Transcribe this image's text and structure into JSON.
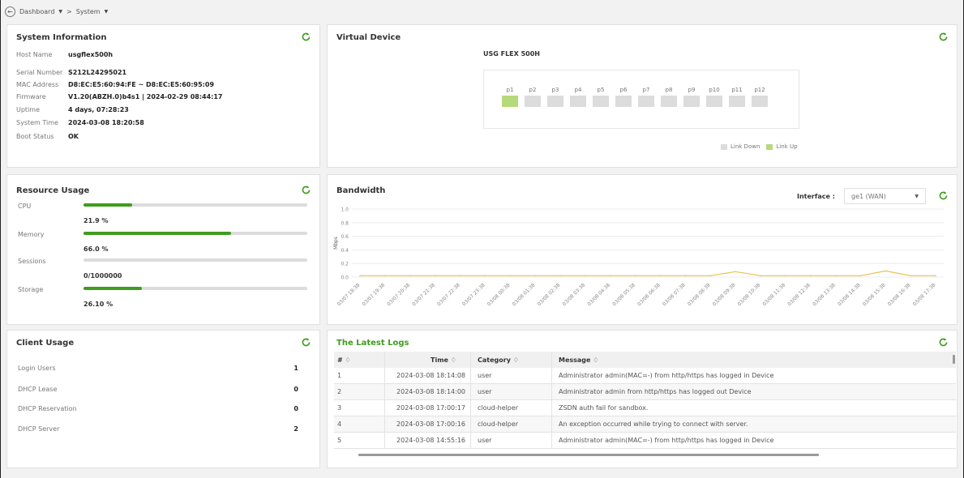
{
  "breadcrumb": {
    "home": "Dashboard",
    "separator": ">",
    "current": "System"
  },
  "colors": {
    "accent": "#3f9c1e",
    "link_up": "#b6d97b",
    "link_down": "#dcdcdc",
    "line": "#e8c24a"
  },
  "system_info": {
    "title": "System Information",
    "rows": [
      {
        "label": "Host Name",
        "value": "usgflex500h"
      },
      {
        "label": "Serial Number",
        "value": "S212L24295021"
      },
      {
        "label": "MAC Address",
        "value": "D8:EC:E5:60:94:FE ~ D8:EC:E5:60:95:09"
      },
      {
        "label": "Firmware",
        "value": "V1.20(ABZH.0)b4s1 | 2024-02-29 08:44:17"
      },
      {
        "label": "Uptime",
        "value": "4 days, 07:28:23"
      },
      {
        "label": "System Time",
        "value": "2024-03-08 18:20:58"
      },
      {
        "label": "Boot Status",
        "value": "OK"
      }
    ]
  },
  "virtual_device": {
    "title": "Virtual Device",
    "model": "USG FLEX 500H",
    "ports": [
      {
        "label": "p1",
        "status": "up"
      },
      {
        "label": "p2",
        "status": "down"
      },
      {
        "label": "p3",
        "status": "down"
      },
      {
        "label": "p4",
        "status": "down"
      },
      {
        "label": "p5",
        "status": "down"
      },
      {
        "label": "p6",
        "status": "down"
      },
      {
        "label": "p7",
        "status": "down"
      },
      {
        "label": "p8",
        "status": "down"
      },
      {
        "label": "p9",
        "status": "down"
      },
      {
        "label": "p10",
        "status": "down"
      },
      {
        "label": "p11",
        "status": "down"
      },
      {
        "label": "p12",
        "status": "down"
      }
    ],
    "legend_down": "Link Down",
    "legend_up": "Link Up"
  },
  "resource_usage": {
    "title": "Resource Usage",
    "items": [
      {
        "label": "CPU",
        "value_text": "21.9 %",
        "fraction": 0.219
      },
      {
        "label": "Memory",
        "value_text": "66.0 %",
        "fraction": 0.66
      },
      {
        "label": "Sessions",
        "value_text": "0/1000000",
        "fraction": 0.0
      },
      {
        "label": "Storage",
        "value_text": "26.10 %",
        "fraction": 0.261
      }
    ]
  },
  "bandwidth": {
    "title": "Bandwidth",
    "interface_label": "Interface :",
    "interface_value": "ge1 (WAN)"
  },
  "chart_data": {
    "type": "line",
    "title": "",
    "xlabel": "",
    "ylabel": "Mbps",
    "ylim": [
      0,
      1.0
    ],
    "yticks": [
      "1.0",
      "0.8",
      "0.6",
      "0.4",
      "0.2",
      "0.0"
    ],
    "categories": [
      "03/07 18:38",
      "03/07 19:38",
      "03/07 20:38",
      "03/07 21:38",
      "03/07 22:38",
      "03/07 23:38",
      "03/08 00:38",
      "03/08 01:38",
      "03/08 02:38",
      "03/08 03:38",
      "03/08 04:38",
      "03/08 05:38",
      "03/08 06:38",
      "03/08 07:38",
      "03/08 08:38",
      "03/08 09:38",
      "03/08 10:38",
      "03/08 11:38",
      "03/08 12:38",
      "03/08 13:38",
      "03/08 14:38",
      "03/08 15:38",
      "03/08 16:38",
      "03/08 17:38"
    ],
    "series": [
      {
        "values": [
          0.02,
          0.02,
          0.02,
          0.02,
          0.02,
          0.02,
          0.02,
          0.02,
          0.02,
          0.02,
          0.02,
          0.02,
          0.02,
          0.02,
          0.02,
          0.08,
          0.02,
          0.02,
          0.02,
          0.02,
          0.02,
          0.09,
          0.02,
          0.02
        ]
      }
    ],
    "grid": true
  },
  "client_usage": {
    "title": "Client Usage",
    "rows": [
      {
        "label": "Login Users",
        "value": "1"
      },
      {
        "label": "DHCP Lease",
        "value": "0"
      },
      {
        "label": "DHCP Reservation",
        "value": "0"
      },
      {
        "label": "DHCP Server",
        "value": "2"
      }
    ]
  },
  "logs": {
    "title": "The Latest Logs",
    "headers": [
      "# ♢",
      "Time ♢",
      "Category ♢",
      "Message ♢"
    ],
    "rows": [
      [
        "1",
        "2024-03-08 18:14:08",
        "user",
        "Administrator admin(MAC=-) from http/https has logged in Device"
      ],
      [
        "2",
        "2024-03-08 18:14:00",
        "user",
        "Administrator admin from http/https has logged out Device"
      ],
      [
        "3",
        "2024-03-08 17:00:17",
        "cloud-helper",
        "ZSDN auth fail for sandbox."
      ],
      [
        "4",
        "2024-03-08 17:00:16",
        "cloud-helper",
        "An exception occurred while trying to connect with server."
      ],
      [
        "5",
        "2024-03-08 14:55:16",
        "user",
        "Administrator admin(MAC=-) from http/https has logged in Device"
      ]
    ]
  }
}
